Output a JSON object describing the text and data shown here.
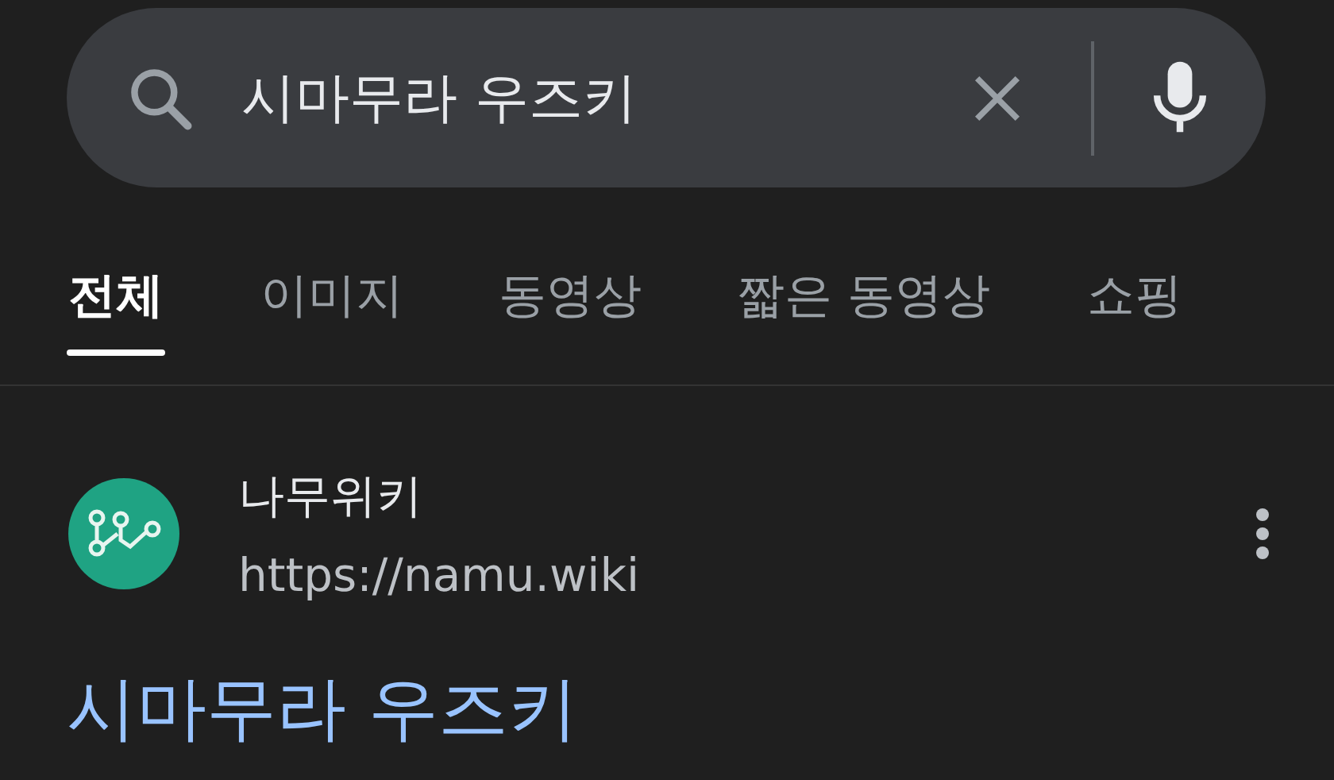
{
  "search": {
    "value": "시마무라 우즈키"
  },
  "tabs": [
    {
      "label": "전체",
      "selected": true
    },
    {
      "label": "이미지",
      "selected": false
    },
    {
      "label": "동영상",
      "selected": false
    },
    {
      "label": "짧은 동영상",
      "selected": false
    },
    {
      "label": "쇼핑",
      "selected": false
    }
  ],
  "result": {
    "site_name": "나무위키",
    "url": "https://namu.wiki",
    "title": "시마무라 우즈키"
  }
}
